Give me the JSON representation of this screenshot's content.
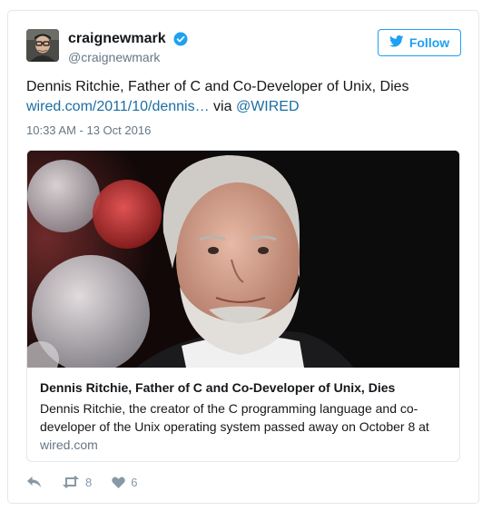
{
  "author": {
    "display_name": "craignewmark",
    "handle": "@craignewmark",
    "verified": true
  },
  "follow_button": {
    "label": "Follow",
    "icon": "twitter-bird-icon"
  },
  "tweet": {
    "text": "Dennis Ritchie, Father of C and Co-Developer of Unix, Dies",
    "link_text": "wired.com/2011/10/dennis…",
    "via_text": "via",
    "mention": "@WIRED",
    "timestamp": "10:33 AM - 13 Oct 2016"
  },
  "card": {
    "title": "Dennis Ritchie, Father of C and Co-Developer of Unix, Dies",
    "description": "Dennis Ritchie, the creator of the C programming language and co-developer of the Unix operating system passed away on October 8 at",
    "domain": "wired.com"
  },
  "actions": {
    "reply_icon": "reply-icon",
    "retweet_icon": "retweet-icon",
    "retweet_count": "8",
    "like_icon": "heart-icon",
    "like_count": "6"
  },
  "colors": {
    "brand_blue": "#1da1f2",
    "link_blue": "#1b6ea3",
    "muted": "#657786",
    "action_gray": "#8899a6",
    "border": "#e1e8ed"
  }
}
